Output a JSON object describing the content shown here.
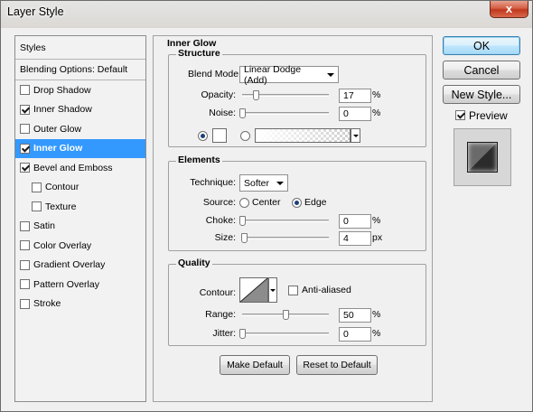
{
  "window": {
    "title": "Layer Style",
    "close_label": "x"
  },
  "styles_list": {
    "header": "Styles",
    "blending": "Blending Options: Default",
    "items": [
      {
        "label": "Drop Shadow",
        "checked": false
      },
      {
        "label": "Inner Shadow",
        "checked": true
      },
      {
        "label": "Outer Glow",
        "checked": false
      },
      {
        "label": "Inner Glow",
        "checked": true,
        "selected": true
      },
      {
        "label": "Bevel and Emboss",
        "checked": true
      },
      {
        "label": "Contour",
        "checked": false,
        "sub": true
      },
      {
        "label": "Texture",
        "checked": false,
        "sub": true
      },
      {
        "label": "Satin",
        "checked": false
      },
      {
        "label": "Color Overlay",
        "checked": false
      },
      {
        "label": "Gradient Overlay",
        "checked": false
      },
      {
        "label": "Pattern Overlay",
        "checked": false
      },
      {
        "label": "Stroke",
        "checked": false
      }
    ]
  },
  "inner_glow": {
    "title": "Inner Glow",
    "structure": {
      "title": "Structure",
      "blend_mode_label": "Blend Mode:",
      "blend_mode_value": "Linear Dodge (Add)",
      "opacity_label": "Opacity:",
      "opacity_value": "17",
      "opacity_unit": "%",
      "noise_label": "Noise:",
      "noise_value": "0",
      "noise_unit": "%",
      "solid_color": "#ffffff",
      "use_solid_color": true
    },
    "elements": {
      "title": "Elements",
      "technique_label": "Technique:",
      "technique_value": "Softer",
      "source_label": "Source:",
      "source_center": "Center",
      "source_edge": "Edge",
      "source_selected": "Edge",
      "choke_label": "Choke:",
      "choke_value": "0",
      "choke_unit": "%",
      "size_label": "Size:",
      "size_value": "4",
      "size_unit": "px"
    },
    "quality": {
      "title": "Quality",
      "contour_label": "Contour:",
      "anti_aliased_label": "Anti-aliased",
      "anti_aliased": false,
      "range_label": "Range:",
      "range_value": "50",
      "range_unit": "%",
      "jitter_label": "Jitter:",
      "jitter_value": "0",
      "jitter_unit": "%"
    },
    "make_default": "Make Default",
    "reset_default": "Reset to Default"
  },
  "buttons": {
    "ok": "OK",
    "cancel": "Cancel",
    "new_style": "New Style...",
    "preview_label": "Preview",
    "preview_checked": true
  },
  "colors": {
    "selection": "#3399ff",
    "ok_border": "#3c7fb1",
    "close_red": "#c0381d"
  }
}
